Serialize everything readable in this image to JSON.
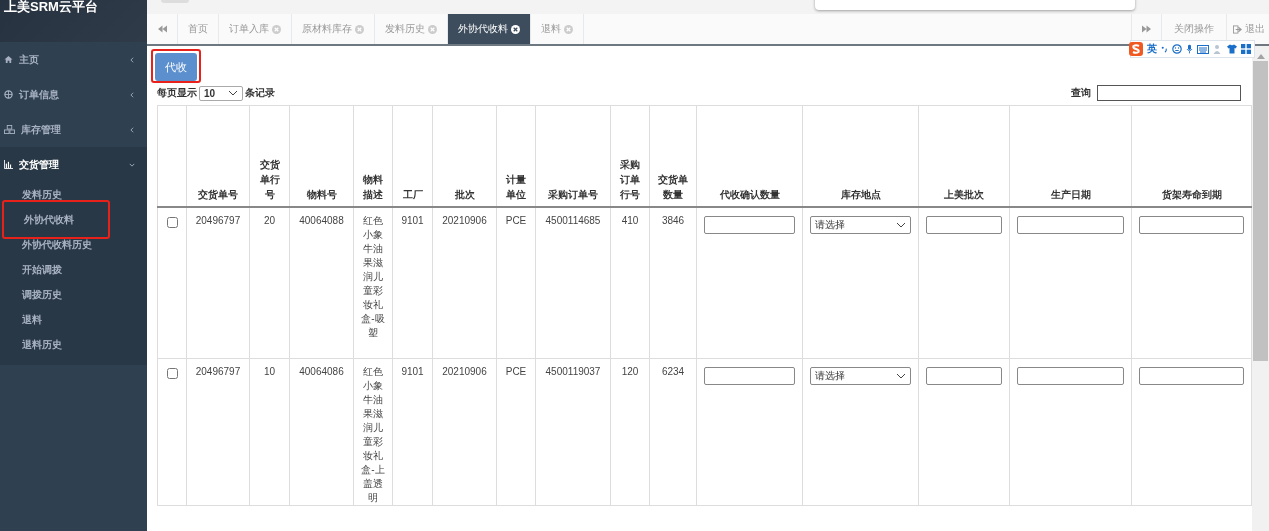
{
  "app_title": "上美SRM云平台",
  "sidebar": {
    "items": [
      {
        "label": "主页",
        "expanded": false
      },
      {
        "label": "订单信息",
        "expanded": false
      },
      {
        "label": "库存管理",
        "expanded": false
      },
      {
        "label": "交货管理",
        "expanded": true,
        "children": [
          {
            "label": "发料历史",
            "highlighted": false
          },
          {
            "label": "外协代收料",
            "highlighted": true
          },
          {
            "label": "外协代收料历史",
            "highlighted": false
          },
          {
            "label": "开始调拨",
            "highlighted": false
          },
          {
            "label": "调拨历史",
            "highlighted": false
          },
          {
            "label": "退料",
            "highlighted": false
          },
          {
            "label": "退料历史",
            "highlighted": false
          }
        ]
      }
    ]
  },
  "tabs": [
    {
      "label": "首页",
      "closable": false,
      "selected": false
    },
    {
      "label": "订单入库",
      "closable": true,
      "selected": false
    },
    {
      "label": "原材料库存",
      "closable": true,
      "selected": false
    },
    {
      "label": "发料历史",
      "closable": true,
      "selected": false
    },
    {
      "label": "外协代收料",
      "closable": true,
      "selected": true
    },
    {
      "label": "退料",
      "closable": true,
      "selected": false
    }
  ],
  "tab_actions": {
    "close_ops": "关闭操作",
    "logout": "退出"
  },
  "ime_toolbar": {
    "mode": "英"
  },
  "action_button": {
    "label": "代收",
    "highlighted": true
  },
  "page_length": {
    "prefix": "每页显示",
    "value": "10",
    "suffix": "条记录"
  },
  "search": {
    "label": "查询"
  },
  "table": {
    "columns": [
      "交货单号",
      "交货单行号",
      "物料号",
      "物料描述",
      "工厂",
      "批次",
      "计量单位",
      "采购订单号",
      "采购订单行号",
      "交货单数量",
      "代收确认数量",
      "库存地点",
      "上美批次",
      "生产日期",
      "货架寿命到期"
    ],
    "rows": [
      {
        "checked": false,
        "cells": [
          "20496797",
          "20",
          "40064088",
          "红色小象牛油果滋润儿童彩妆礼盒-吸塑",
          "9101",
          "20210906",
          "PCE",
          "4500114685",
          "410",
          "3846"
        ],
        "location": "请选择"
      },
      {
        "checked": false,
        "cells": [
          "20496797",
          "10",
          "40064086",
          "红色小象牛油果滋润儿童彩妆礼盒-上盖透明",
          "9101",
          "20210906",
          "PCE",
          "4500119037",
          "120",
          "6234"
        ],
        "location": "请选择"
      }
    ]
  }
}
